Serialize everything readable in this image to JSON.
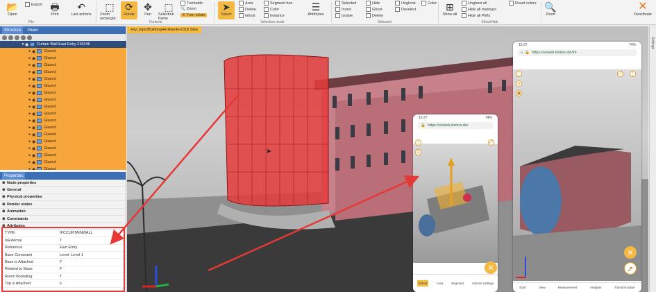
{
  "ribbon": {
    "file_group": {
      "label": "File",
      "open": "Open",
      "export": "Export",
      "print": "Print",
      "last_actions": "Last actions"
    },
    "controls_group": {
      "label": "Controls",
      "zoom_rect": "Zoom rectangle",
      "rotate": "Rotate",
      "pan": "Pan",
      "selection_frame": "Selection frame",
      "turntable": "Turntable",
      "zoom": "Zoom",
      "free_rotate": "Free rotate"
    },
    "selection_group": {
      "label": "Selection mode",
      "select": "Select",
      "area": "Area",
      "delete": "Delete",
      "ghost": "Ghost",
      "segment_box": "Segment box",
      "color": "Color",
      "instance": "Instance",
      "attributes": "Attributes"
    },
    "selected_group": {
      "label": "Selected",
      "selected": "Selected",
      "invert": "Invert",
      "isolate": "Isolate",
      "hide": "Hide",
      "delete": "Delete",
      "ghost": "Ghost",
      "unghost": "Unghost",
      "deselect": "Deselect",
      "color": "Color"
    },
    "showhide_group": {
      "label": "Show/Hide",
      "show_all": "Show all",
      "unghost_all": "Unghost all",
      "hide_all_markups": "Hide all markups",
      "hide_all_pmis": "Hide all PMIs",
      "reset_colors": "Reset colors",
      "zoom": "Zoom"
    },
    "deactivate": "Deactivate"
  },
  "structure_panel": {
    "tab_structure": "Structure",
    "tab_views": "Views",
    "root_item": "Curtain Wall East Entry 218146",
    "items": [
      "Glazed",
      "Glazed",
      "Glazed",
      "Glazed",
      "Glazed",
      "Glazed",
      "Glazed",
      "Glazed",
      "Glazed",
      "Glazed",
      "Glazed",
      "Glazed",
      "Glazed",
      "Glazed",
      "Glazed",
      "Glazed",
      "Glazed",
      "Glazed",
      "Glazed",
      "Glazed"
    ]
  },
  "properties_panel": {
    "title": "Properties",
    "categories": [
      "Node properties",
      "General",
      "Physical properties",
      "Render states",
      "Animation",
      "Constraints",
      "Attributes"
    ],
    "attributes": [
      {
        "key": "TYPE",
        "value": "IFCCURTAINWALL"
      },
      {
        "key": "IsExternal",
        "value": "T"
      },
      {
        "key": "Reference",
        "value": "East Entry"
      },
      {
        "key": "Base Constraint",
        "value": "Level: Level 1"
      },
      {
        "key": "Base is Attached",
        "value": "F"
      },
      {
        "key": "Related to Mass",
        "value": "F"
      },
      {
        "key": "Room Bounding",
        "value": "T"
      },
      {
        "key": "Top is Attached",
        "value": "F"
      }
    ]
  },
  "viewport": {
    "tab_title": "+by_topic/Building/Hi-Rise/H-2018.3dvs"
  },
  "right_strip": {
    "label": "Settings"
  },
  "phone_small": {
    "time": "15:27",
    "battery": "74%",
    "url": "https://vsweb.kisters.de/",
    "bottom_tabs": [
      "Select",
      "Area",
      "Segment",
      "Actions settings"
    ]
  },
  "phone_large": {
    "time": "15:27",
    "battery": "74%",
    "url": "https://vsweb.kisters.de/int",
    "bottom_tabs": [
      "Start",
      "View",
      "Measurement",
      "Analysis",
      "Transformation"
    ]
  },
  "colors": {
    "accent": "#f4b942",
    "panel_header": "#3d6fb6",
    "highlight_red": "#e53935",
    "tree_bg": "#f6a63a"
  }
}
